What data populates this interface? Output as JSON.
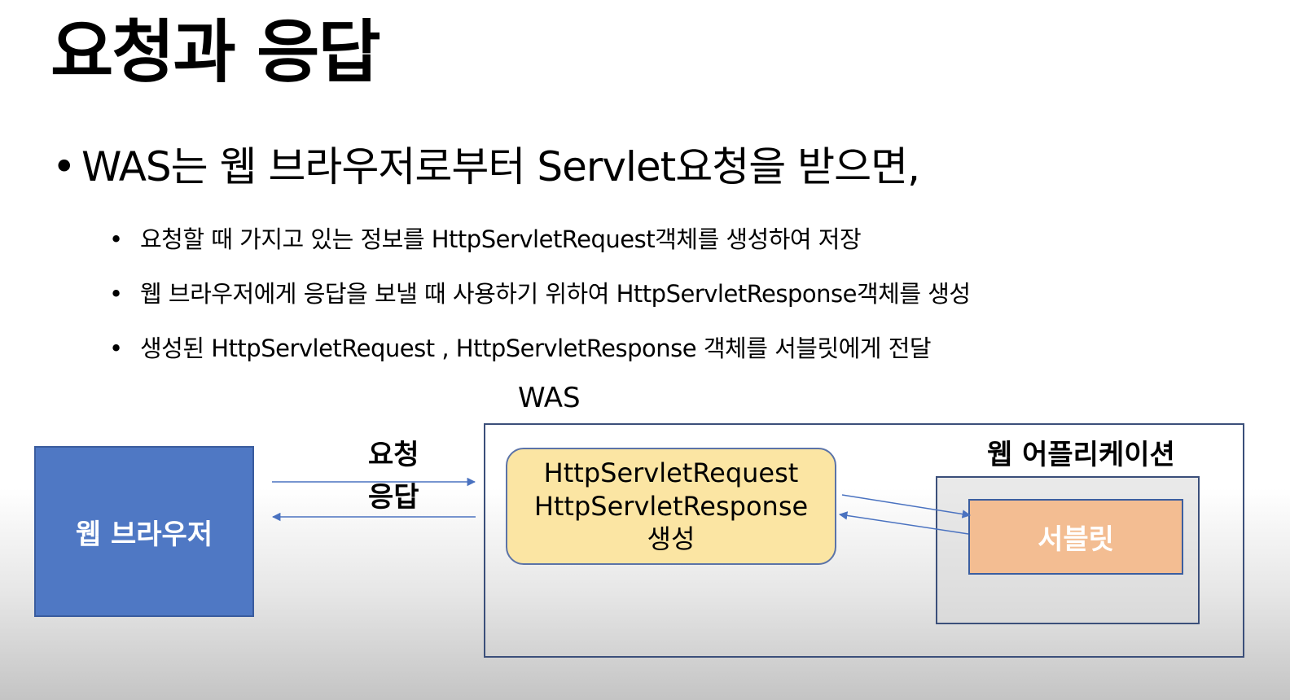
{
  "slide": {
    "title": "요청과 응답",
    "bullet_char": "•",
    "main_bullet": "WAS는 웹 브라우저로부터 Servlet요청을 받으면,",
    "sub_bullets": [
      "요청할 때 가지고 있는 정보를 HttpServletRequest객체를 생성하여 저장",
      "웹 브라우저에게 응답을 보낼 때 사용하기 위하여 HttpServletResponse객체를 생성",
      "생성된 HttpServletRequest , HttpServletResponse  객체를 서블릿에게 전달"
    ]
  },
  "diagram": {
    "was_label": "WAS",
    "browser_label": "웹 브라우저",
    "request_label": "요청",
    "response_label": "응답",
    "create_box": {
      "line1": "HttpServletRequest",
      "line2": "HttpServletResponse",
      "line3": "생성"
    },
    "webapp_label": "웹 어플리케이션",
    "servlet_label": "서블릿",
    "colors": {
      "browser_fill": "#4f78c4",
      "create_fill": "#fbe5a3",
      "servlet_fill": "#f3bd92",
      "arrow": "#4a72c0"
    }
  }
}
